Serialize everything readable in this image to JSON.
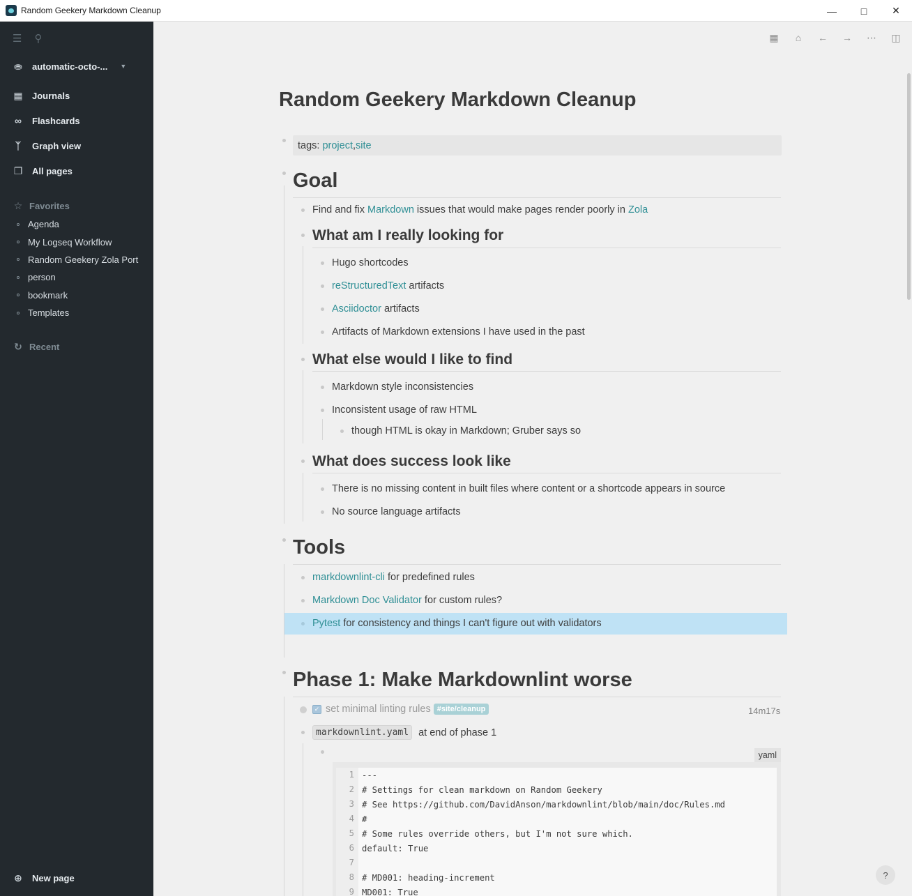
{
  "window": {
    "title": "Random Geekery Markdown Cleanup",
    "min_icon": "minimize-icon",
    "max_icon": "maximize-icon",
    "close_icon": "close-icon"
  },
  "sidebar": {
    "graph_name": "automatic-octo-...",
    "nav": [
      {
        "label": "Journals",
        "icon": "calendar-icon"
      },
      {
        "label": "Flashcards",
        "icon": "infinity-icon"
      },
      {
        "label": "Graph view",
        "icon": "graph-icon"
      },
      {
        "label": "All pages",
        "icon": "pages-icon"
      }
    ],
    "favorites_label": "Favorites",
    "favorites": [
      "Agenda",
      "My Logseq Workflow",
      "Random Geekery Zola Port",
      "person",
      "bookmark",
      "Templates"
    ],
    "recent_label": "Recent",
    "new_page_label": "New page"
  },
  "page": {
    "title": "Random Geekery Markdown Cleanup",
    "tags_prefix": "tags: ",
    "tag1": "project",
    "tag_sep": ", ",
    "tag2": "site",
    "goal": {
      "heading": "Goal",
      "line_pre": "Find and fix ",
      "line_link1": "Markdown",
      "line_mid": " issues that would make pages render poorly in ",
      "line_link2": "Zola",
      "sub1": {
        "heading": "What am I really looking for",
        "item1": "Hugo shortcodes",
        "item2_link": "reStructuredText",
        "item2_rest": " artifacts",
        "item3_link": "Asciidoctor",
        "item3_rest": " artifacts",
        "item4": "Artifacts of Markdown extensions I have used in the past"
      },
      "sub2": {
        "heading": "What else would I like to find",
        "item1": "Markdown style inconsistencies",
        "item2": "Inconsistent usage of raw HTML",
        "item2_child": "though HTML is okay in Markdown; Gruber says so"
      },
      "sub3": {
        "heading": "What does success look like",
        "item1": "There is no missing content in built files where content or a shortcode appears in source",
        "item2": "No source language artifacts"
      }
    },
    "tools": {
      "heading": "Tools",
      "item1_link": "markdownlint-cli",
      "item1_rest": " for predefined rules",
      "item2_link": "Markdown Doc Validator",
      "item2_rest": " for custom rules?",
      "item3_link": "Pytest",
      "item3_rest": " for consistency and things I can't figure out with validators"
    },
    "phase1": {
      "heading": "Phase 1: Make Markdownlint worse",
      "task_text": "set minimal linting rules",
      "task_tag": "#site/cleanup",
      "task_time": "14m17s",
      "file_code": "markdownlint.yaml",
      "file_rest": " at end of phase 1",
      "code_lang": "yaml",
      "code_lines": [
        {
          "n": "1",
          "t": "---"
        },
        {
          "n": "2",
          "t": "# Settings for clean markdown on Random Geekery"
        },
        {
          "n": "3",
          "t": "# See https://github.com/DavidAnson/markdownlint/blob/main/doc/Rules.md"
        },
        {
          "n": "4",
          "t": "#"
        },
        {
          "n": "5",
          "t": "# Some rules override others, but I'm not sure which."
        },
        {
          "n": "6",
          "t": "default: True"
        },
        {
          "n": "7",
          "t": ""
        },
        {
          "n": "8",
          "t": "# MD001: heading-increment"
        },
        {
          "n": "9",
          "t": "MD001: True"
        }
      ]
    },
    "help": "?"
  }
}
